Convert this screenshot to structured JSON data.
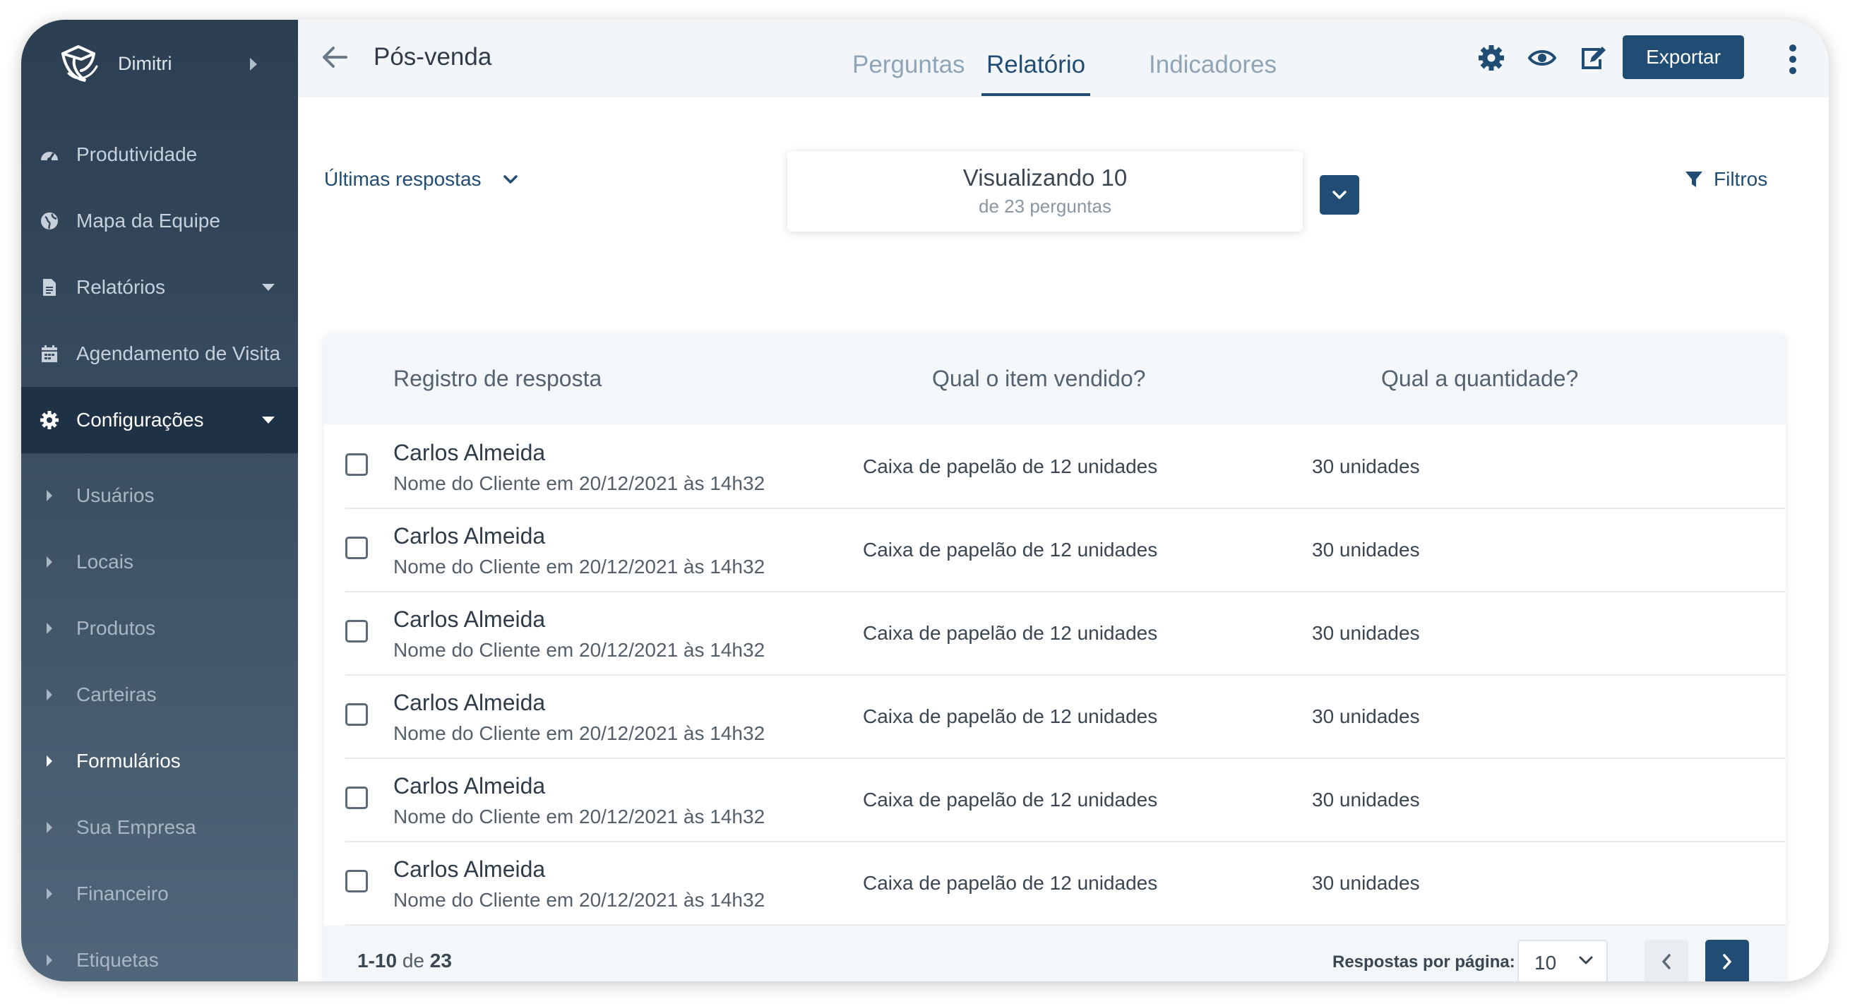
{
  "colors": {
    "primary": "#214d74",
    "sidebar": "#2c3e52",
    "sidebar_active": "#1f3145"
  },
  "sidebar": {
    "user_name": "Dimitri",
    "items": [
      {
        "label": "Produtividade",
        "icon": "speedometer-icon"
      },
      {
        "label": "Mapa da Equipe",
        "icon": "globe-icon"
      },
      {
        "label": "Relatórios",
        "icon": "document-icon"
      },
      {
        "label": "Agendamento de Visita",
        "icon": "calendar-icon"
      },
      {
        "label": "Configurações",
        "icon": "gear-icon"
      }
    ],
    "sub_items": [
      "Usuários",
      "Locais",
      "Produtos",
      "Carteiras",
      "Formulários",
      "Sua Empresa",
      "Financeiro",
      "Etiquetas"
    ]
  },
  "header": {
    "title": "Pós-venda",
    "tabs": [
      "Perguntas",
      "Relatório",
      "Indicadores"
    ],
    "active_tab": "Relatório",
    "export_label": "Exportar"
  },
  "toolbar": {
    "ultimas_label": "Últimas respostas",
    "viz_title": "Visualizando 10",
    "viz_sub": "de 23 perguntas",
    "filtros_label": "Filtros"
  },
  "table": {
    "columns": [
      "Registro de resposta",
      "Qual o item vendido?",
      "Qual a quantidade?"
    ],
    "rows": [
      {
        "name": "Carlos Almeida",
        "meta": "Nome do Cliente em 20/12/2021 às 14h32",
        "item": "Caixa de papelão de 12 unidades",
        "qty": "30 unidades"
      },
      {
        "name": "Carlos Almeida",
        "meta": "Nome do Cliente em 20/12/2021 às 14h32",
        "item": "Caixa de papelão de 12 unidades",
        "qty": "30 unidades"
      },
      {
        "name": "Carlos Almeida",
        "meta": "Nome do Cliente em 20/12/2021 às 14h32",
        "item": "Caixa de papelão de 12 unidades",
        "qty": "30 unidades"
      },
      {
        "name": "Carlos Almeida",
        "meta": "Nome do Cliente em 20/12/2021 às 14h32",
        "item": "Caixa de papelão de 12 unidades",
        "qty": "30 unidades"
      },
      {
        "name": "Carlos Almeida",
        "meta": "Nome do Cliente em 20/12/2021 às 14h32",
        "item": "Caixa de papelão de 12 unidades",
        "qty": "30 unidades"
      },
      {
        "name": "Carlos Almeida",
        "meta": "Nome do Cliente em 20/12/2021 às 14h32",
        "item": "Caixa de papelão de 12 unidades",
        "qty": "30 unidades"
      }
    ]
  },
  "pagination": {
    "range": "1-10",
    "of_label": "de",
    "total": "23",
    "per_page_label": "Respostas por página:",
    "per_page_value": "10"
  }
}
